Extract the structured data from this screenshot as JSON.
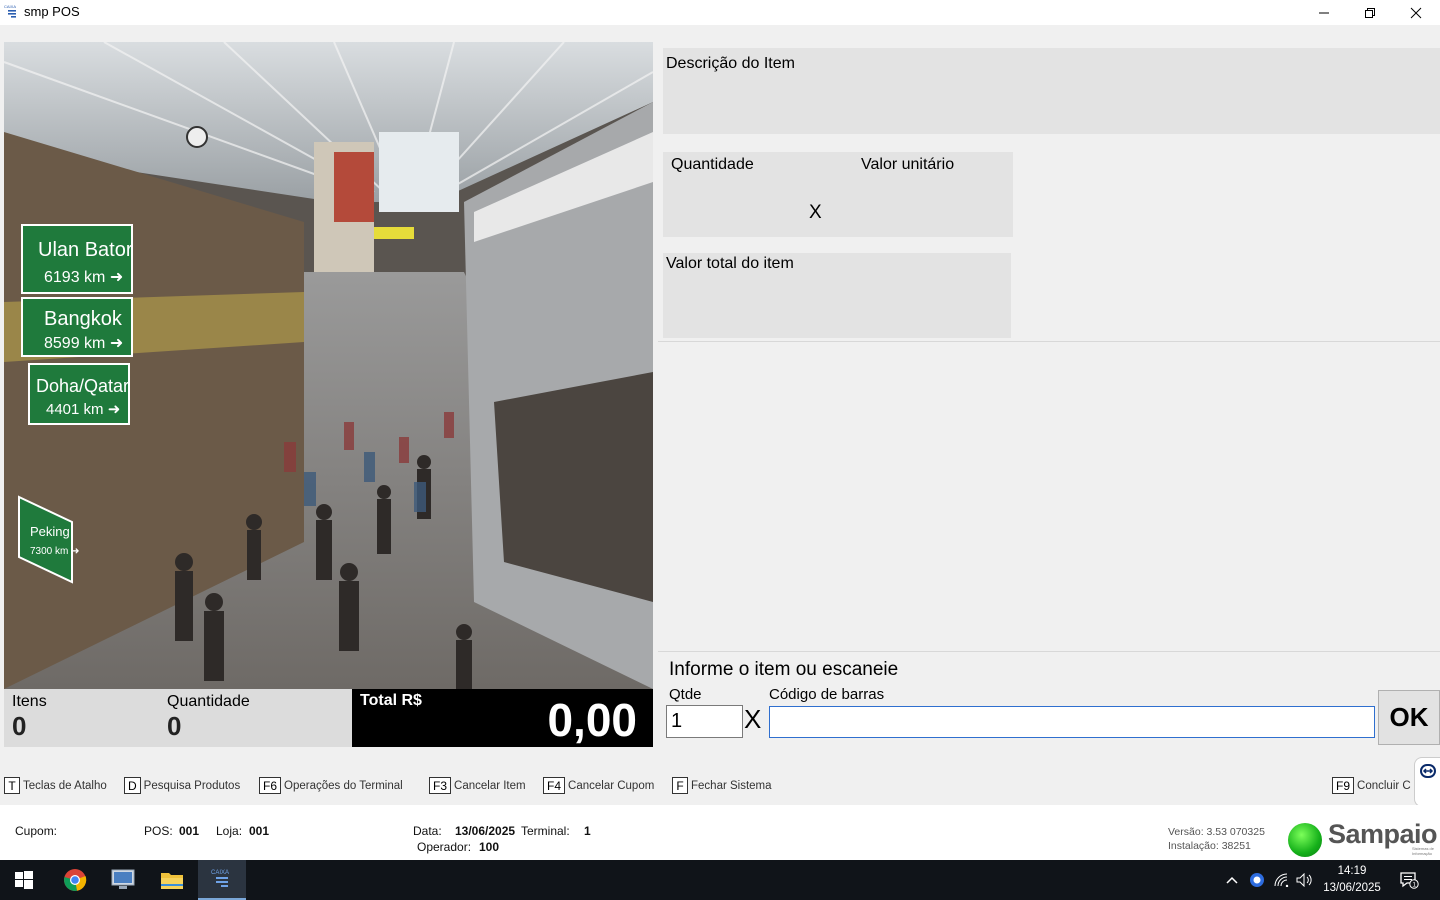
{
  "window": {
    "title": "smp POS",
    "icon_label": "CAIXA",
    "controls": [
      "minimize-icon",
      "restore-icon",
      "close-icon"
    ]
  },
  "photo": {
    "signs": [
      {
        "city": "Ulan Bator",
        "distance": "6193 km ➜"
      },
      {
        "city": "Bangkok",
        "distance": "8599 km ➜"
      },
      {
        "city": "Doha/Qatar",
        "distance": "4401 km ➜"
      },
      {
        "city": "Peking",
        "distance": "7300 km ➜"
      }
    ]
  },
  "item_info": {
    "description_label": "Descrição do Item",
    "description_value": "",
    "quantity_label": "Quantidade",
    "multiply_sign": "X",
    "unit_price_label": "Valor unitário",
    "item_total_label": "Valor total do item"
  },
  "totals": {
    "items_label": "Itens",
    "items_value": "0",
    "quantity_label": "Quantidade",
    "quantity_value": "0",
    "total_label": "Total R$",
    "total_value": "0,00"
  },
  "entry": {
    "heading": "Informe o item ou escaneie",
    "qty_label": "Qtde",
    "qty_value": "1",
    "multiply_sign": "X",
    "barcode_label": "Código de barras",
    "barcode_value": "",
    "ok_label": "OK"
  },
  "shortcuts": [
    {
      "key": "T",
      "label": "Teclas de Atalho"
    },
    {
      "key": "D",
      "label": "Pesquisa Produtos"
    },
    {
      "key": "F6",
      "label": "Operações do Terminal"
    },
    {
      "key": "F3",
      "label": "Cancelar Item"
    },
    {
      "key": "F4",
      "label": "Cancelar Cupom"
    },
    {
      "key": "F",
      "label": "Fechar Sistema"
    },
    {
      "key": "F9",
      "label": "Concluir C"
    }
  ],
  "status": {
    "cupom_label": "Cupom:",
    "cupom_value": "",
    "pos_label": "POS:",
    "pos_value": "001",
    "loja_label": "Loja:",
    "loja_value": "001",
    "data_label": "Data:",
    "data_value": "13/06/2025",
    "terminal_label": "Terminal:",
    "terminal_value": "1",
    "operador_label": "Operador:",
    "operador_value": "100",
    "versao": "Versão: 3.53 070325",
    "instalacao": "Instalação: 38251",
    "logo_text": "Sampaio",
    "logo_subtext": "Sistemas de Informação"
  },
  "taskbar": {
    "apps": [
      "windows-start-icon",
      "chrome-icon",
      "remote-desktop-icon",
      "file-explorer-icon",
      "smp-pos-icon"
    ],
    "time": "14:19",
    "date": "13/06/2025",
    "notification_count": "1"
  },
  "colors": {
    "panel_gray": "#e3e3e3",
    "total_bg": "#000000",
    "input_focus_border": "#2f6fcf",
    "logo_green": "#15b01a",
    "taskbar_bg": "#101419"
  }
}
